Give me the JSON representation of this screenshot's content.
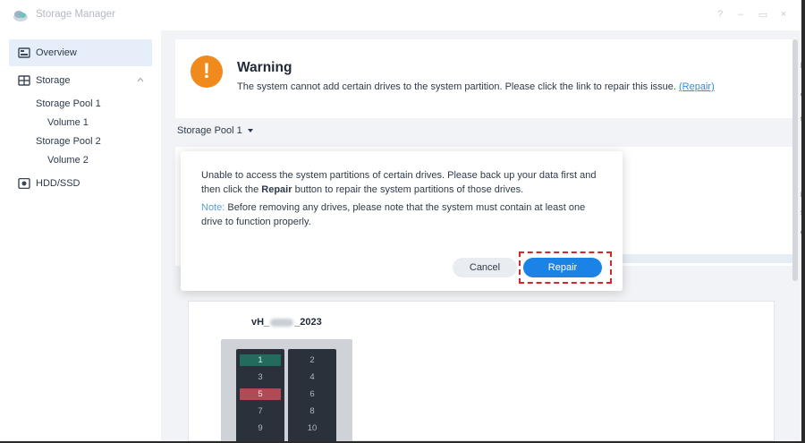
{
  "window": {
    "title": "Storage Manager",
    "controls": {
      "help": "?",
      "minimize": "–",
      "maximize": "▭",
      "close": "×"
    }
  },
  "sidebar": {
    "items": [
      {
        "label": "Overview",
        "icon": "overview-icon",
        "active": true
      },
      {
        "label": "Storage",
        "icon": "storage-icon",
        "expanded": true
      },
      {
        "label": "HDD/SSD",
        "icon": "disk-icon"
      }
    ],
    "storage_children": [
      {
        "label": "Storage Pool 1",
        "level": 1
      },
      {
        "label": "Volume 1",
        "level": 2
      },
      {
        "label": "Storage Pool 2",
        "level": 1
      },
      {
        "label": "Volume 2",
        "level": 2
      }
    ]
  },
  "warning": {
    "icon_glyph": "!",
    "title": "Warning",
    "message": "The system cannot add certain drives to the system partition. Please click the link to repair this issue.",
    "link_text": "(Repair)"
  },
  "pool_selector": {
    "selected": "Storage Pool 1"
  },
  "device": {
    "name_prefix": "vH_",
    "name_suffix": "_2023",
    "bays_left": [
      "1",
      "3",
      "5",
      "7",
      "9"
    ],
    "bays_right": [
      "2",
      "4",
      "6",
      "8",
      "10"
    ]
  },
  "dialog": {
    "text_before": "Unable to access the system partitions of certain drives. Please back up your data first and then click the ",
    "text_bold": "Repair",
    "text_after": " button to repair the system partitions of those drives.",
    "note_label": "Note:",
    "note_text": " Before removing any drives, please note that the system must contain at least one drive to function properly.",
    "cancel_label": "Cancel",
    "repair_label": "Repair"
  },
  "colors": {
    "accent": "#1b82e6",
    "warning": "#f08a1c",
    "highlight": "#d9262b",
    "bay_healthy": "#236b5d",
    "bay_error": "#b04a55"
  },
  "edge_glyphs": [
    "h",
    "e",
    "t",
    "i",
    "s",
    "d"
  ]
}
